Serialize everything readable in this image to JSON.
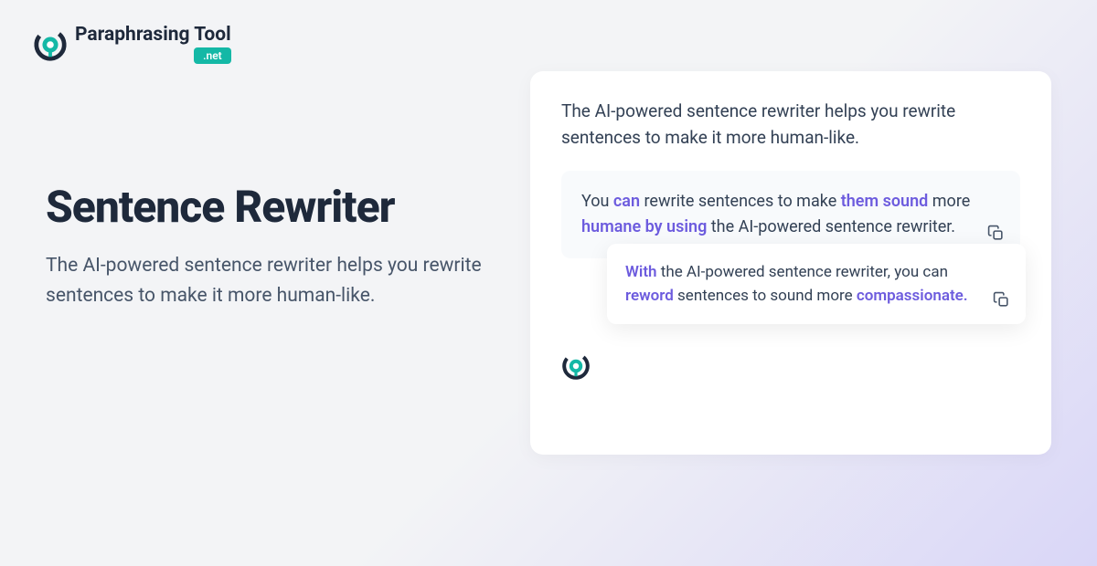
{
  "brand": {
    "name": "Paraphrasing Tool",
    "badge": ".net"
  },
  "hero": {
    "title": "Sentence Rewriter",
    "description": "The AI-powered sentence rewriter helps you rewrite sentences to make it more human-like."
  },
  "demo": {
    "intro": "The AI-powered sentence rewriter helps you rewrite sentences to make it more human-like.",
    "result1": {
      "segments": [
        {
          "text": "You ",
          "highlight": false
        },
        {
          "text": "can",
          "highlight": true
        },
        {
          "text": " rewrite sentences to make ",
          "highlight": false
        },
        {
          "text": "them sound",
          "highlight": true
        },
        {
          "text": " more ",
          "highlight": false
        },
        {
          "text": "humane by using",
          "highlight": true
        },
        {
          "text": " the AI-powered sentence rewriter.",
          "highlight": false
        }
      ]
    },
    "result2": {
      "segments": [
        {
          "text": "With",
          "highlight": true
        },
        {
          "text": " the AI-powered sentence rewriter, you can ",
          "highlight": false
        },
        {
          "text": "reword",
          "highlight": true
        },
        {
          "text": " sentences to sound more ",
          "highlight": false
        },
        {
          "text": "compassionate.",
          "highlight": true
        }
      ]
    }
  },
  "colors": {
    "accent": "#6d5cde",
    "teal": "#14b8a6",
    "text_dark": "#1e293b",
    "text_body": "#475569"
  }
}
